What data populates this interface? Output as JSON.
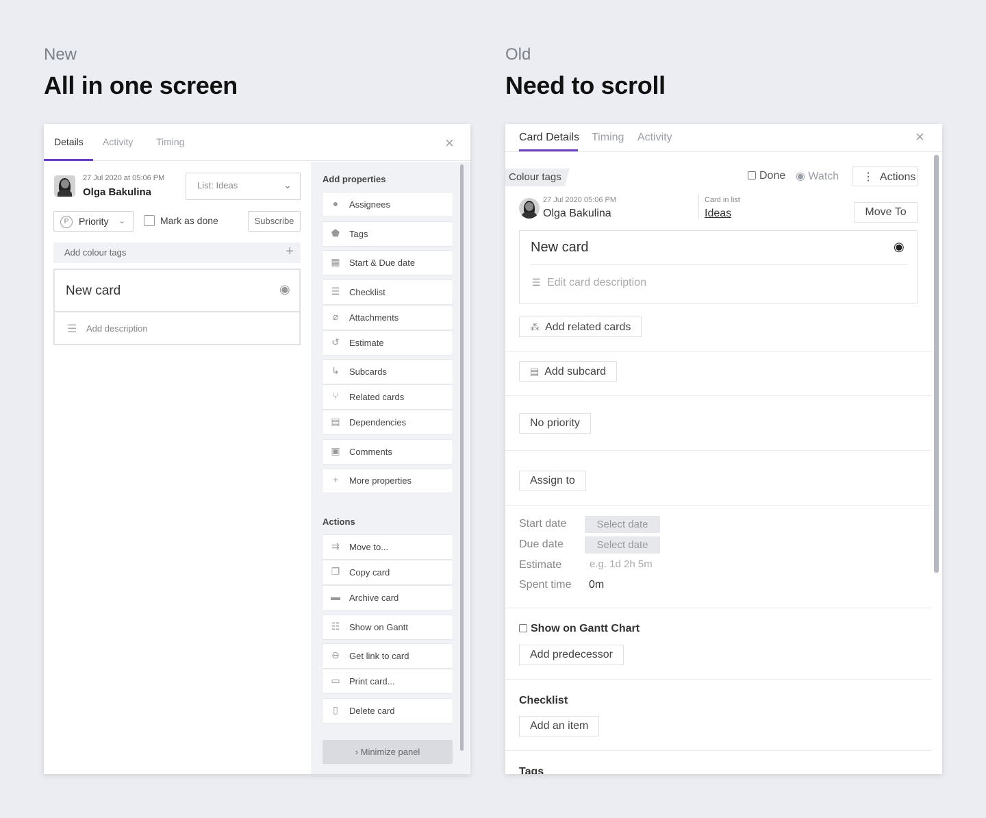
{
  "captions": {
    "new": {
      "kicker": "New",
      "headline": "All in one screen"
    },
    "old": {
      "kicker": "Old",
      "headline": "Need to scroll"
    }
  },
  "new_panel": {
    "tabs": [
      "Details",
      "Activity",
      "Timing"
    ],
    "active_tab": "Details",
    "close_icon": "×",
    "meta": {
      "date": "27 Jul 2020 at 05:06 PM",
      "author": "Olga Bakulina"
    },
    "list_select": "List: Ideas",
    "priority": {
      "icon": "P",
      "label": "Priority"
    },
    "mark_as_done": "Mark as done",
    "subscribe": "Subscribe",
    "add_colour_tags": "Add colour tags",
    "card": {
      "title": "New card",
      "description_placeholder": "Add description"
    },
    "add_properties": {
      "title": "Add properties",
      "items": [
        {
          "label": "Assignees",
          "icon": "person-icon",
          "glyph": "●"
        },
        {
          "label": "Tags",
          "icon": "tag-icon",
          "glyph": "⬟"
        },
        {
          "label": "Start & Due date",
          "icon": "calendar-icon",
          "glyph": "▦"
        },
        {
          "label": "Checklist",
          "icon": "checklist-icon",
          "glyph": "☰"
        },
        {
          "label": "Attachments",
          "icon": "paperclip-icon",
          "glyph": "⌀"
        },
        {
          "label": "Estimate",
          "icon": "history-icon",
          "glyph": "↺"
        },
        {
          "label": "Subcards",
          "icon": "subcard-icon",
          "glyph": "↳"
        },
        {
          "label": "Related cards",
          "icon": "branch-icon",
          "glyph": "⑂"
        },
        {
          "label": "Dependencies",
          "icon": "dependencies-icon",
          "glyph": "▤"
        },
        {
          "label": "Comments",
          "icon": "comments-icon",
          "glyph": "▣"
        },
        {
          "label": "More properties",
          "icon": "plus-icon",
          "glyph": "+"
        }
      ]
    },
    "actions": {
      "title": "Actions",
      "items": [
        {
          "label": "Move to...",
          "icon": "move-icon",
          "glyph": "⇉"
        },
        {
          "label": "Copy card",
          "icon": "copy-icon",
          "glyph": "❐"
        },
        {
          "label": "Archive card",
          "icon": "archive-icon",
          "glyph": "▬"
        },
        {
          "label": "Show on Gantt",
          "icon": "gantt-icon",
          "glyph": "☷"
        },
        {
          "label": "Get link to card",
          "icon": "link-icon",
          "glyph": "⊖"
        },
        {
          "label": "Print card...",
          "icon": "print-icon",
          "glyph": "▭"
        },
        {
          "label": "Delete card",
          "icon": "trash-icon",
          "glyph": "▯"
        }
      ]
    },
    "minimize": "›   Minimize panel"
  },
  "old_panel": {
    "tabs": [
      "Card Details",
      "Timing",
      "Activity"
    ],
    "active_tab": "Card Details",
    "close_icon": "×",
    "colour_tags": "Colour tags",
    "done": "Done",
    "watch": "Watch",
    "actions": "Actions",
    "meta": {
      "date": "27 Jul 2020 05:06 PM",
      "author": "Olga Bakulina"
    },
    "card_in_list": {
      "label": "Card in list",
      "value": "Ideas"
    },
    "move_to": "Move To",
    "card": {
      "title": "New card",
      "description_placeholder": "Edit card description"
    },
    "add_related_cards": "Add related cards",
    "add_subcard": "Add subcard",
    "no_priority": "No priority",
    "assign_to": "Assign to",
    "dates": {
      "start_label": "Start date",
      "start_value": "Select date",
      "due_label": "Due date",
      "due_value": "Select date",
      "estimate_label": "Estimate",
      "estimate_placeholder": "e.g. 1d 2h 5m",
      "spent_label": "Spent time",
      "spent_value": "0m"
    },
    "show_on_gantt": "Show on Gantt Chart",
    "add_predecessor": "Add predecessor",
    "checklist_title": "Checklist",
    "add_item": "Add an item",
    "tags_title": "Tags"
  }
}
